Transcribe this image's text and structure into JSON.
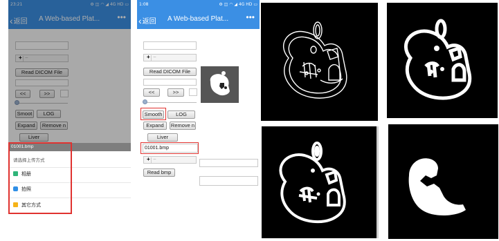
{
  "phones": [
    {
      "status_time": "23:21",
      "status_icons": "⚙ ◫ ◠ ◢ 4G HD ▭",
      "back_label": "返回",
      "title": "A Web-based Plat...",
      "more": "•••",
      "buttons": {
        "read_dicom": "Read DICOM File",
        "prev": "<<",
        "next": ">>",
        "smooth": "Smoot",
        "log": "LOG",
        "expand": "Expand",
        "remove": "Remove n",
        "liver": "Liver"
      },
      "sheet": {
        "file_label": "01001.bmp",
        "prompt": "请选择上传方式",
        "options": [
          "相册",
          "拍照",
          "其它方式"
        ]
      }
    },
    {
      "status_time": "1:08",
      "status_icons": "⚙ ◫ ◠ ◢ 4G HD ▭",
      "back_label": "返回",
      "title": "A Web-based Plat...",
      "more": "•••",
      "buttons": {
        "read_dicom": "Read DICOM File",
        "prev": "<<",
        "next": ">>",
        "smooth": "Smooth",
        "log": "LOG",
        "expand": "Expand",
        "remove": "Remove n",
        "liver": "Liver",
        "read_bmp": "Read bmp"
      },
      "file_value": "01001.bmp"
    }
  ],
  "colors": {
    "nav_blue": "#3b8fe4",
    "highlight_red": "#e0322f",
    "icon_green": "#2fb57a",
    "icon_blue": "#2f8fe6",
    "icon_yellow": "#f5b319"
  },
  "panels": [
    {
      "name": "edge-outline"
    },
    {
      "name": "thick-contour"
    },
    {
      "name": "filled-contour"
    },
    {
      "name": "liver-segment"
    }
  ]
}
